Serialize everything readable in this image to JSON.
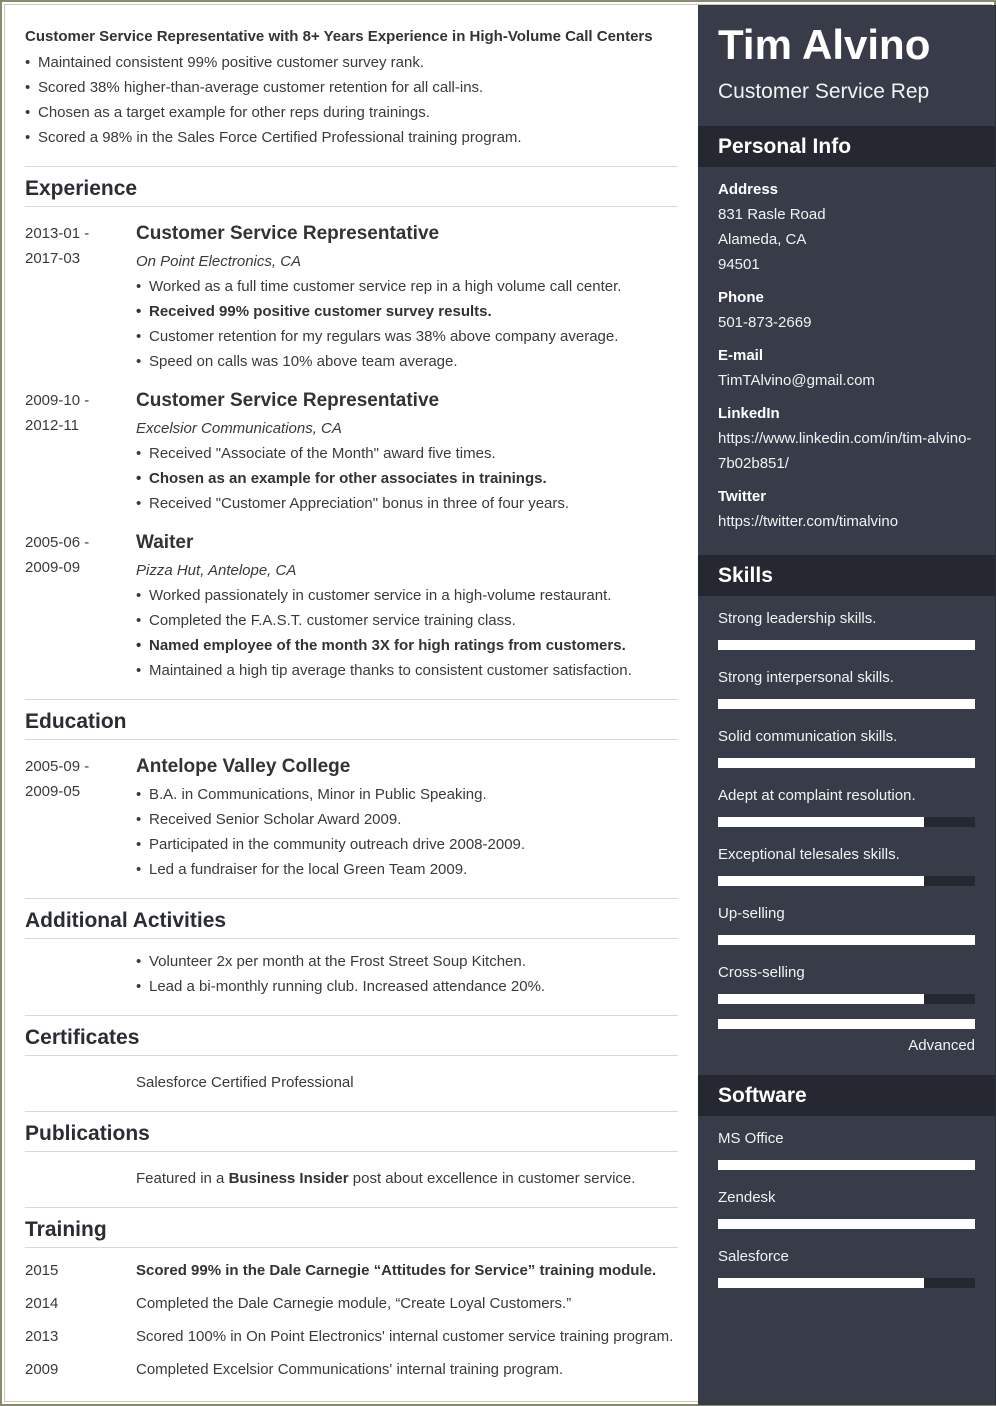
{
  "summary": {
    "title": "Customer Service Representative with 8+ Years Experience in High-Volume Call Centers",
    "bullets": [
      "Maintained consistent 99% positive customer survey rank.",
      "Scored 38% higher-than-average customer retention for all call-ins.",
      "Chosen as a target example for other reps during trainings.",
      "Scored a 98% in the Sales Force Certified Professional training program."
    ]
  },
  "experience": {
    "title": "Experience",
    "entries": [
      {
        "date_start": "2013-01 -",
        "date_end": "2017-03",
        "title": "Customer Service Representative",
        "company": "On Point Electronics, CA",
        "bullets": [
          "Worked as a full time customer service rep in a high volume call center.",
          "Received 99% positive customer survey results.",
          "Customer retention for my regulars was 38% above company average.",
          "Speed on calls was 10% above team average."
        ]
      },
      {
        "date_start": "2009-10 -",
        "date_end": "2012-11",
        "title": "Customer Service Representative",
        "company": "Excelsior Communications, CA",
        "bullets": [
          "Received \"Associate of the Month\" award five times.",
          "Chosen as an example for other associates in trainings.",
          "Received \"Customer Appreciation\" bonus in three of four years."
        ]
      },
      {
        "date_start": "2005-06 -",
        "date_end": "2009-09",
        "title": "Waiter",
        "company": "Pizza Hut, Antelope, CA",
        "bullets": [
          "Worked passionately in customer service in a high-volume restaurant.",
          "Completed the F.A.S.T. customer service training class.",
          "Named employee of the month 3X for high ratings from customers.",
          "Maintained a high tip average thanks to consistent customer satisfaction."
        ]
      }
    ]
  },
  "education": {
    "title": "Education",
    "entry": {
      "date_start": "2005-09 -",
      "date_end": "2009-05",
      "title": "Antelope Valley College",
      "bullets": [
        "B.A. in Communications, Minor in Public Speaking.",
        "Received Senior Scholar Award 2009.",
        "Participated in the community outreach drive 2008-2009.",
        "Led a fundraiser for the local Green Team 2009."
      ]
    }
  },
  "activities": {
    "title": "Additional Activities",
    "bullets": [
      "Volunteer 2x per month at the Frost Street Soup Kitchen.",
      "Lead a bi-monthly running club. Increased attendance 20%."
    ]
  },
  "certificates": {
    "title": "Certificates",
    "text": "Salesforce Certified Professional"
  },
  "publications": {
    "title": "Publications",
    "text_before": "Featured in a ",
    "text_bold": "Business Insider",
    "text_after": " post about excellence in customer service."
  },
  "training": {
    "title": "Training",
    "rows": [
      {
        "year": "2015",
        "text": "Scored 99% in the Dale Carnegie “Attitudes for Service” training module."
      },
      {
        "year": "2014",
        "text": "Completed the Dale Carnegie module, “Create Loyal Customers.”"
      },
      {
        "year": "2013",
        "text": "Scored 100% in On Point Electronics' internal customer service training program."
      },
      {
        "year": "2009",
        "text": "Completed Excelsior Communications' internal training program."
      }
    ]
  },
  "sidebar": {
    "name": "Tim Alvino",
    "role": "Customer Service Rep",
    "personal_info": {
      "title": "Personal Info",
      "address_label": "Address",
      "address_lines": [
        "831 Rasle Road",
        "Alameda, CA",
        "94501"
      ],
      "phone_label": "Phone",
      "phone": "501-873-2669",
      "email_label": "E-mail",
      "email": "TimTAlvino@gmail.com",
      "linkedin_label": "LinkedIn",
      "linkedin": "https://www.linkedin.com/in/tim-alvino-7b02b851/",
      "twitter_label": "Twitter",
      "twitter": "https://twitter.com/timalvino"
    },
    "skills": {
      "title": "Skills",
      "items": [
        {
          "name": "Strong leadership skills.",
          "level": 1.0
        },
        {
          "name": "Strong interpersonal skills.",
          "level": 1.0
        },
        {
          "name": "Solid communication skills.",
          "level": 1.0
        },
        {
          "name": "Adept at complaint resolution.",
          "level": 0.8
        },
        {
          "name": "Exceptional telesales skills.",
          "level": 0.8
        },
        {
          "name": "Up-selling",
          "level": 1.0
        },
        {
          "name": "Cross-selling",
          "level": 0.8
        }
      ],
      "legend_label": "Advanced"
    },
    "software": {
      "title": "Software",
      "items": [
        {
          "name": "MS Office",
          "level": 1.0
        },
        {
          "name": "Zendesk",
          "level": 1.0
        },
        {
          "name": "Salesforce",
          "level": 0.8
        }
      ]
    }
  }
}
